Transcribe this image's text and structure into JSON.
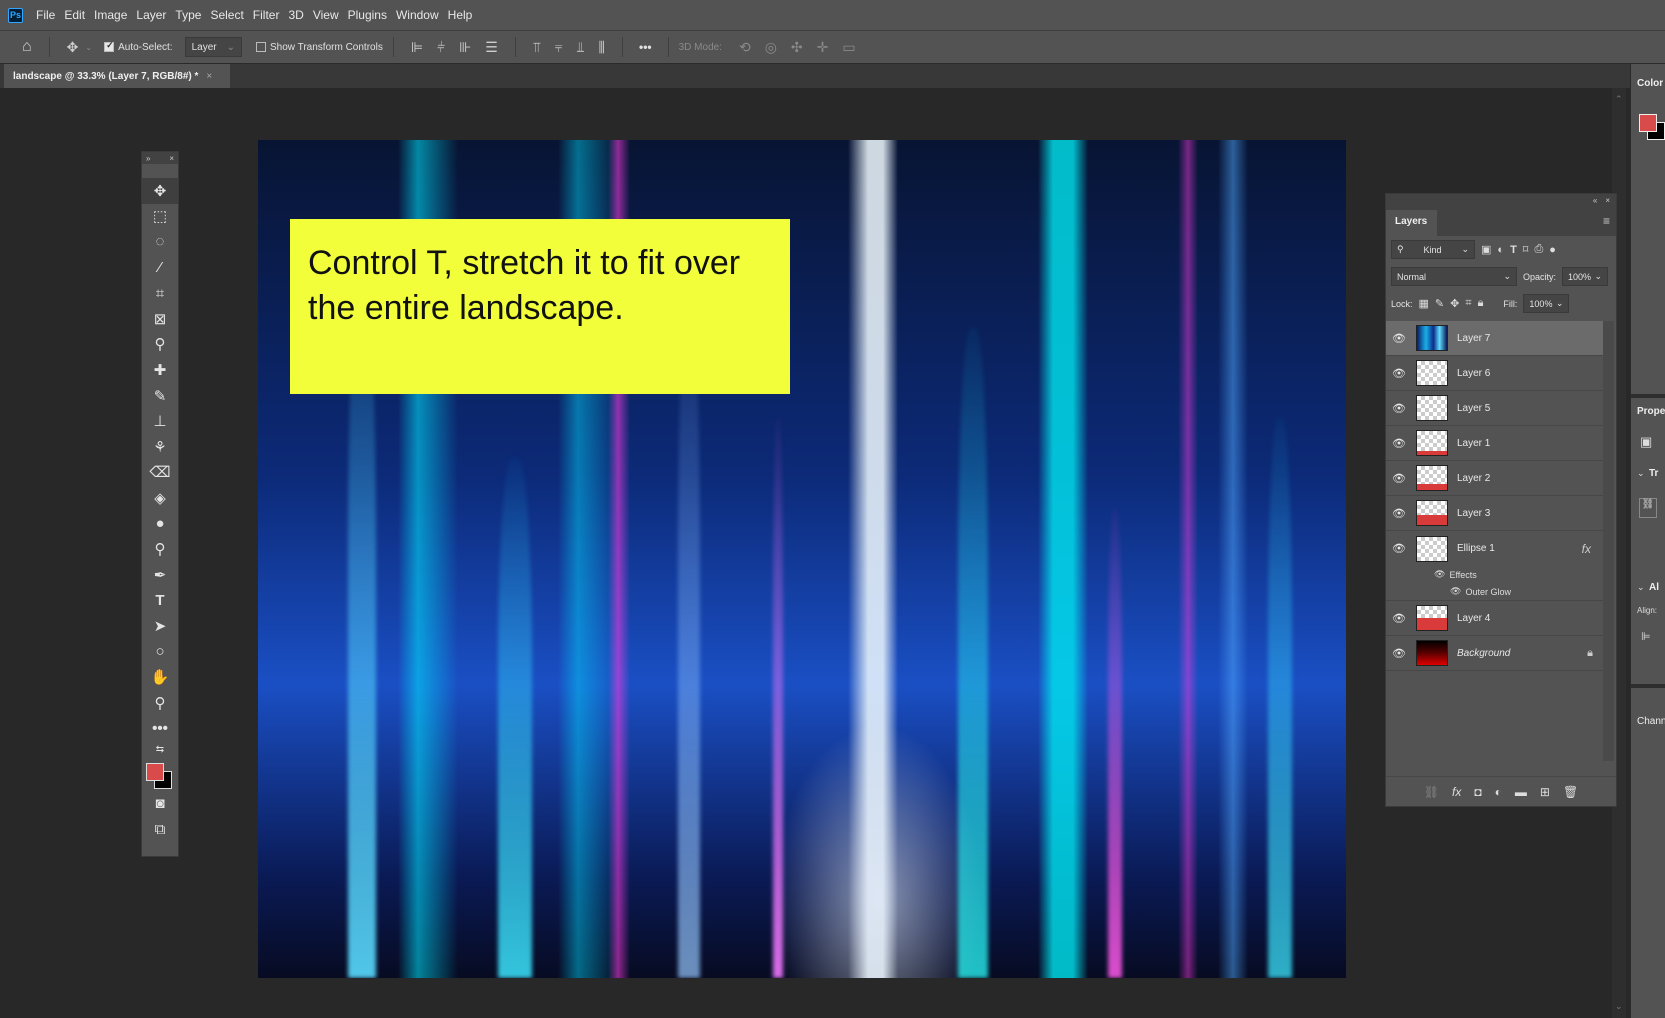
{
  "app": {
    "logo": "Ps",
    "menu": [
      "File",
      "Edit",
      "Image",
      "Layer",
      "Type",
      "Select",
      "Filter",
      "3D",
      "View",
      "Plugins",
      "Window",
      "Help"
    ]
  },
  "options_bar": {
    "auto_select_label": "Auto-Select:",
    "auto_select_value": "Layer",
    "show_transform_label": "Show Transform Controls",
    "three_d_mode_label": "3D Mode:",
    "more_label": "•••"
  },
  "document": {
    "tab_title": "landscape @ 33.3% (Layer 7, RGB/8#) *",
    "close_glyph": "×"
  },
  "annotation": {
    "text": "Control T, stretch it to fit over the entire landscape."
  },
  "layers_panel": {
    "title": "Layers",
    "filter_kind": "Kind",
    "blend_mode": "Normal",
    "opacity_label": "Opacity:",
    "opacity_value": "100%",
    "lock_label": "Lock:",
    "fill_label": "Fill:",
    "fill_value": "100%",
    "effects_label": "Effects",
    "outer_glow_label": "Outer Glow",
    "layers": [
      {
        "name": "Layer 7",
        "selected": true
      },
      {
        "name": "Layer 6"
      },
      {
        "name": "Layer 5"
      },
      {
        "name": "Layer 1"
      },
      {
        "name": "Layer 2"
      },
      {
        "name": "Layer 3"
      },
      {
        "name": "Ellipse 1",
        "fx": "fx"
      },
      {
        "name": "Layer 4"
      },
      {
        "name": "Background",
        "locked": true
      }
    ]
  },
  "dock": {
    "color_label": "Color",
    "properties_label": "Prope",
    "transform_label": "Tr",
    "align_section_label": "Al",
    "align_label": "Align:",
    "channels_label": "Chann"
  },
  "colors": {
    "foreground": "#d94a4a",
    "background": "#000000",
    "annotation_bg": "#f2fe3a"
  }
}
